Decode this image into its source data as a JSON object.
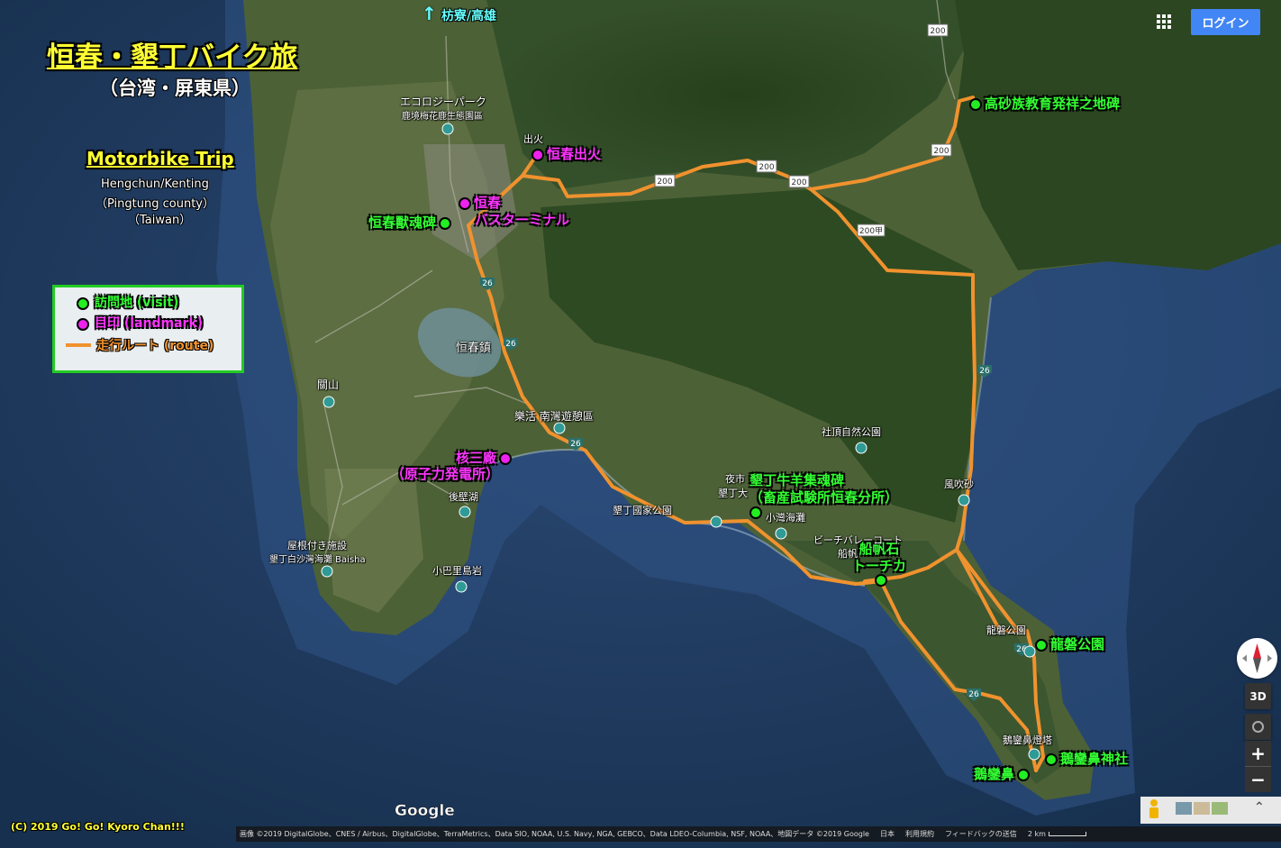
{
  "title": {
    "main": "恒春・墾丁バイク旅",
    "sub": "（台湾・屏東県）"
  },
  "en_title": {
    "main": "Motorbike Trip",
    "line1": "Hengchun/Kenting",
    "line2": "（Pingtung county）",
    "line3": "（Taiwan）"
  },
  "north": {
    "arrow": "↑",
    "label": "枋寮/高雄"
  },
  "legend": {
    "visit": "訪問地 (visit)",
    "landmark": "目印 (landmark)",
    "route": "走行ルート (route)"
  },
  "visits": [
    {
      "label": "高砂族教育発祥之地碑"
    },
    {
      "label": "恒春獸魂碑"
    },
    {
      "label": "墾丁牛羊集魂碑"
    },
    {
      "label": "（畜産試験所恒春分所）"
    },
    {
      "label": "船帆石"
    },
    {
      "label": "トーチカ"
    },
    {
      "label": "龍磐公園"
    },
    {
      "label": "鵝鑾鼻神社"
    },
    {
      "label": "鵝鑾鼻"
    }
  ],
  "landmarks": [
    {
      "label": "恒春出火"
    },
    {
      "label": "恒春"
    },
    {
      "label": "バスターミナル"
    },
    {
      "label": "核三廠"
    },
    {
      "label": "（原子力発電所）"
    }
  ],
  "place_labels": {
    "eco1": "エコロジーパーク",
    "eco2": "鹿境梅花鹿生態園區",
    "chuhuo": "出火",
    "hengchun_town": "恒春鎮",
    "guanshan": "關山",
    "leisure": "樂活 南灣遊憩區",
    "shezding": "社頂自然公園",
    "yeshi": "夜市",
    "kending": "墾丁大",
    "xiaowan": "小灣海灘",
    "kending_np": "墾丁國家公園",
    "beach_court": "ビーチバレーコート",
    "chuanfan": "船帆",
    "fengchuisha": "風吹砂",
    "longpan": "龍磐公園",
    "lighthouse": "鵝鑾鼻燈塔",
    "houbi": "後壁湖",
    "xiaobali": "小巴里島岩",
    "baisha1": "屋根付き施設",
    "baisha2": "墾丁白沙灣海灘 Baisha"
  },
  "road_shields": [
    "200",
    "200",
    "200",
    "200",
    "200",
    "200甲",
    "26",
    "26",
    "26",
    "26",
    "26",
    "26"
  ],
  "map_ui": {
    "login": "ログイン",
    "google": "Google",
    "view_3d": "3D",
    "zoom_in": "+",
    "zoom_out": "−",
    "attribution": "画像 ©2019 DigitalGlobe、CNES / Airbus、DigitalGlobe、TerraMetrics、Data SIO, NOAA, U.S. Navy, NGA, GEBCO、Data LDEO-Columbia, NSF, NOAA、地図データ ©2019 Google",
    "region": "日本",
    "terms": "利用規約",
    "feedback": "フィードバックの送信",
    "scale": "2 km",
    "copyright": "(C) 2019 Go! Go! Kyoro Chan!!!"
  },
  "colors": {
    "ocean": "#1f3b63",
    "land": "#4d6137",
    "route": "#f0922e",
    "visit": "#22ee22",
    "landmark": "#ee22ee"
  }
}
